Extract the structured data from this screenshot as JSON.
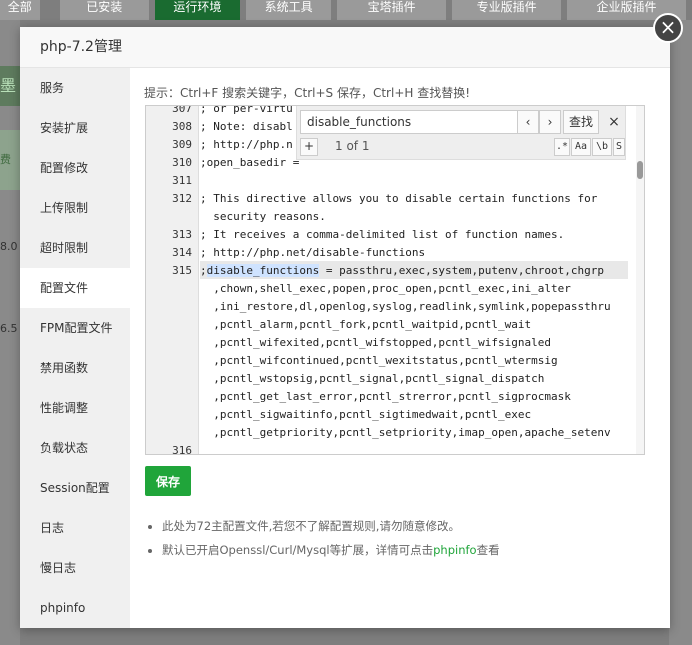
{
  "background": {
    "tabs": [
      {
        "label": "全部"
      },
      {
        "label": "已安装"
      },
      {
        "label": "运行环境",
        "active": true
      },
      {
        "label": "系统工具"
      },
      {
        "label": "宝塔插件"
      },
      {
        "label": "专业版插件"
      },
      {
        "label": "企业版插件"
      }
    ],
    "left_fragments": [
      "墨",
      "费",
      "8.0",
      "6.5"
    ]
  },
  "dialog": {
    "title": "php-7.2管理",
    "close_icon": "×"
  },
  "nav": {
    "items": [
      {
        "label": "服务"
      },
      {
        "label": "安装扩展"
      },
      {
        "label": "配置修改"
      },
      {
        "label": "上传限制"
      },
      {
        "label": "超时限制"
      },
      {
        "label": "配置文件",
        "active": true
      },
      {
        "label": "FPM配置文件"
      },
      {
        "label": "禁用函数"
      },
      {
        "label": "性能调整"
      },
      {
        "label": "负载状态"
      },
      {
        "label": "Session配置"
      },
      {
        "label": "日志"
      },
      {
        "label": "慢日志"
      },
      {
        "label": "phpinfo"
      }
    ]
  },
  "content": {
    "hint": "提示：Ctrl+F 搜索关键字，Ctrl+S 保存，Ctrl+H 查找替换!",
    "save_label": "保存",
    "notes": [
      "此处为72主配置文件,若您不了解配置规则,请勿随意修改。",
      "默认已开启Openssl/Curl/Mysql等扩展，详情可点击",
      "phpinfo",
      "查看"
    ]
  },
  "search": {
    "value": "disable_functions",
    "prev": "‹",
    "next": "›",
    "find_label": "查找",
    "close": "×",
    "plus": "+",
    "count": "1 of 1",
    "opt_regex": ".*",
    "opt_case": "Aa",
    "opt_word": "\\b",
    "opt_sel": "S"
  },
  "editor": {
    "line_numbers": [
      "307",
      "308",
      "309",
      "310",
      "311",
      "312",
      "313",
      "314",
      "315",
      "316"
    ],
    "lines": [
      "; or per-virtu",
      "; Note: disabl",
      "; http://php.n",
      ";open_basedir =",
      "",
      "; This directive allows you to disable certain functions for",
      "  security reasons.",
      "; It receives a comma-delimited list of function names.",
      "; http://php.net/disable-functions",
      ";",
      "disable_functions",
      " = passthru,exec,system,putenv,chroot,chgrp",
      "  ,chown,shell_exec,popen,proc_open,pcntl_exec,ini_alter",
      "  ,ini_restore,dl,openlog,syslog,readlink,symlink,popepassthru",
      "  ,pcntl_alarm,pcntl_fork,pcntl_waitpid,pcntl_wait",
      "  ,pcntl_wifexited,pcntl_wifstopped,pcntl_wifsignaled",
      "  ,pcntl_wifcontinued,pcntl_wexitstatus,pcntl_wtermsig",
      "  ,pcntl_wstopsig,pcntl_signal,pcntl_signal_dispatch",
      "  ,pcntl_get_last_error,pcntl_strerror,pcntl_sigprocmask",
      "  ,pcntl_sigwaitinfo,pcntl_sigtimedwait,pcntl_exec",
      "  ,pcntl_getpriority,pcntl_setpriority,imap_open,apache_setenv"
    ]
  }
}
